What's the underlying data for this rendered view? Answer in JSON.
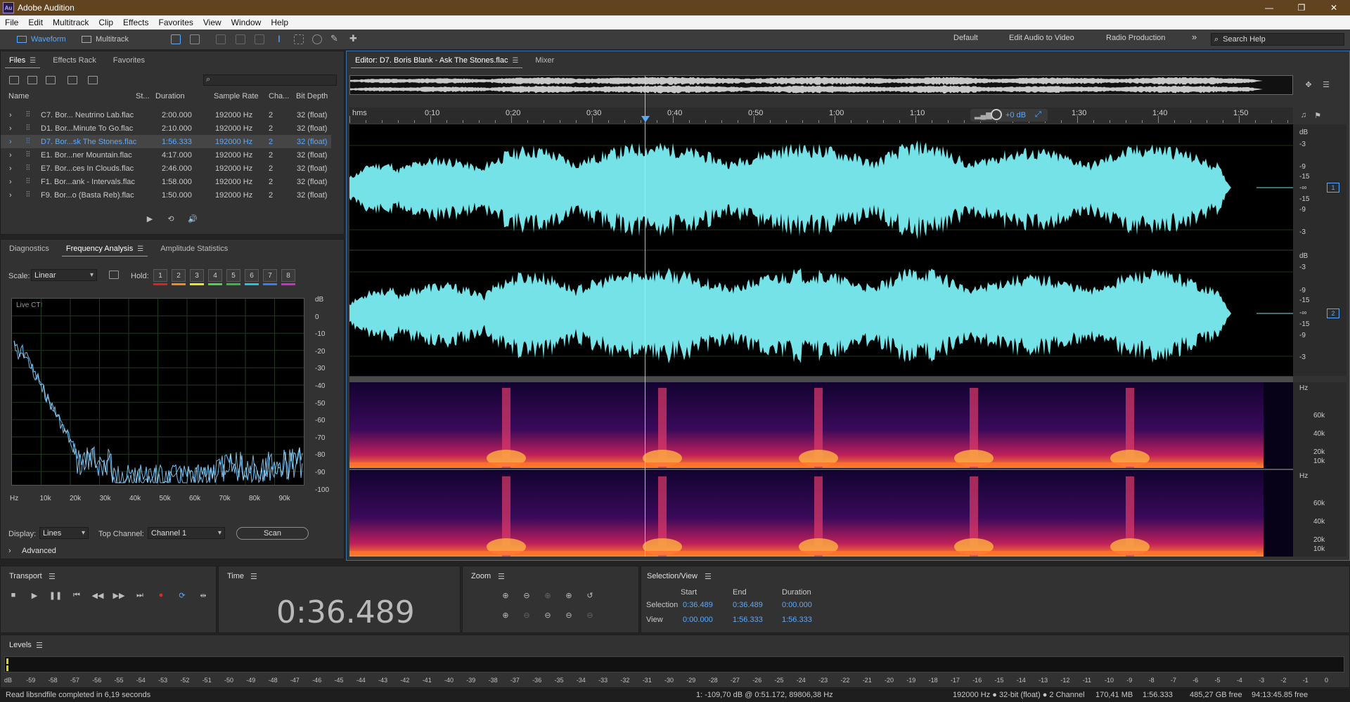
{
  "app": {
    "title": "Adobe Audition",
    "icon_text": "Au"
  },
  "window_controls": {
    "minimize": "—",
    "restore": "❐",
    "close": "✕"
  },
  "menu": [
    "File",
    "Edit",
    "Multitrack",
    "Clip",
    "Effects",
    "Favorites",
    "View",
    "Window",
    "Help"
  ],
  "toolbar": {
    "waveform": "Waveform",
    "multitrack": "Multitrack",
    "workspaces": [
      "Default",
      "Edit Audio to Video",
      "Radio Production"
    ],
    "more": "»",
    "search_placeholder": "Search Help"
  },
  "files_panel": {
    "tabs": [
      "Files",
      "Effects Rack",
      "Favorites"
    ],
    "search_placeholder": "",
    "columns": [
      "Name",
      "St...",
      "Duration",
      "Sample Rate",
      "Cha...",
      "Bit Depth"
    ],
    "rows": [
      {
        "name": "C7. Bor... Neutrino Lab.flac",
        "duration": "2:00.000",
        "rate": "192000 Hz",
        "ch": "2",
        "bits": "32 (float)"
      },
      {
        "name": "D1. Bor...Minute To Go.flac",
        "duration": "2:10.000",
        "rate": "192000 Hz",
        "ch": "2",
        "bits": "32 (float)"
      },
      {
        "name": "D7. Bor...sk The Stones.flac",
        "duration": "1:56.333",
        "rate": "192000 Hz",
        "ch": "2",
        "bits": "32 (float)"
      },
      {
        "name": "E1. Bor...ner Mountain.flac",
        "duration": "4:17.000",
        "rate": "192000 Hz",
        "ch": "2",
        "bits": "32 (float)"
      },
      {
        "name": "E7. Bor...ces In Clouds.flac",
        "duration": "2:46.000",
        "rate": "192000 Hz",
        "ch": "2",
        "bits": "32 (float)"
      },
      {
        "name": "F1. Bor...ank - Intervals.flac",
        "duration": "1:58.000",
        "rate": "192000 Hz",
        "ch": "2",
        "bits": "32 (float)"
      },
      {
        "name": "F9. Bor...o (Basta Reb).flac",
        "duration": "1:50.000",
        "rate": "192000 Hz",
        "ch": "2",
        "bits": "32 (float)"
      }
    ]
  },
  "analysis_panel": {
    "tabs": [
      "Diagnostics",
      "Frequency Analysis",
      "Amplitude Statistics"
    ],
    "scale_label": "Scale:",
    "scale_value": "Linear",
    "hold_label": "Hold:",
    "hold_buttons": [
      "1",
      "2",
      "3",
      "4",
      "5",
      "6",
      "7",
      "8"
    ],
    "hold_colors": [
      "#e02020",
      "#f08a1c",
      "#e8e81c",
      "#4fd14f",
      "#3ab54a",
      "#22c4d8",
      "#3a7cf0",
      "#d22ad2"
    ],
    "graph_label": "Live CTI",
    "db_axis": [
      "dB",
      "0",
      "-10",
      "-20",
      "-30",
      "-40",
      "-50",
      "-60",
      "-70",
      "-80",
      "-90",
      "-100"
    ],
    "hz_axis": [
      "Hz",
      "10k",
      "20k",
      "30k",
      "40k",
      "50k",
      "60k",
      "70k",
      "80k",
      "90k"
    ],
    "display_label": "Display:",
    "display_value": "Lines",
    "top_channel_label": "Top Channel:",
    "top_channel_value": "Channel 1",
    "scan": "Scan",
    "advanced": "Advanced"
  },
  "editor": {
    "tabs": [
      "Editor: D7. Boris Blank - Ask The Stones.flac",
      "Mixer"
    ],
    "ruler": [
      "hms",
      "0:10",
      "0:20",
      "0:30",
      "0:40",
      "0:50",
      "1:00",
      "1:10",
      "1:30",
      "1:40",
      "1:50"
    ],
    "gain": "+0 dB",
    "db_scale_1": [
      "dB",
      "-3",
      "-9",
      "-15",
      "-∞",
      "-15",
      "-9",
      "-3"
    ],
    "db_scale_2": [
      "dB",
      "-3",
      "-9",
      "-15",
      "-∞",
      "-15",
      "-9",
      "-3"
    ],
    "channel_1": "1",
    "channel_2": "2",
    "hz_scale_1": [
      "Hz",
      "60k",
      "40k",
      "20k",
      "10k"
    ],
    "hz_scale_2": [
      "Hz",
      "60k",
      "40k",
      "20k",
      "10k"
    ]
  },
  "transport": {
    "title": "Transport"
  },
  "time_panel": {
    "title": "Time",
    "value": "0:36.489"
  },
  "zoom_panel": {
    "title": "Zoom"
  },
  "selection": {
    "title": "Selection/View",
    "headers": [
      "Start",
      "End",
      "Duration"
    ],
    "selection_label": "Selection",
    "selection_values": [
      "0:36.489",
      "0:36.489",
      "0:00.000"
    ],
    "view_label": "View",
    "view_values": [
      "0:00.000",
      "1:56.333",
      "1:56.333"
    ]
  },
  "levels": {
    "title": "Levels",
    "scale": [
      "dB",
      "-59",
      "-58",
      "-57",
      "-56",
      "-55",
      "-54",
      "-53",
      "-52",
      "-51",
      "-50",
      "-49",
      "-48",
      "-47",
      "-46",
      "-45",
      "-44",
      "-43",
      "-42",
      "-41",
      "-40",
      "-39",
      "-38",
      "-37",
      "-36",
      "-35",
      "-34",
      "-33",
      "-32",
      "-31",
      "-30",
      "-29",
      "-28",
      "-27",
      "-26",
      "-25",
      "-24",
      "-23",
      "-22",
      "-21",
      "-20",
      "-19",
      "-18",
      "-17",
      "-16",
      "-15",
      "-14",
      "-13",
      "-12",
      "-11",
      "-10",
      "-9",
      "-8",
      "-7",
      "-6",
      "-5",
      "-4",
      "-3",
      "-2",
      "-1",
      "0"
    ]
  },
  "status": {
    "message": "Read libsndfile completed in 6,19 seconds",
    "cursor": "1: -109,70 dB @ 0:51.172, 89806,38 Hz",
    "format": "192000 Hz ● 32-bit (float) ● 2 Channel",
    "size": "170,41 MB",
    "duration": "1:56.333",
    "free": "485,27 GB free",
    "time_free": "94:13:45.85 free"
  }
}
